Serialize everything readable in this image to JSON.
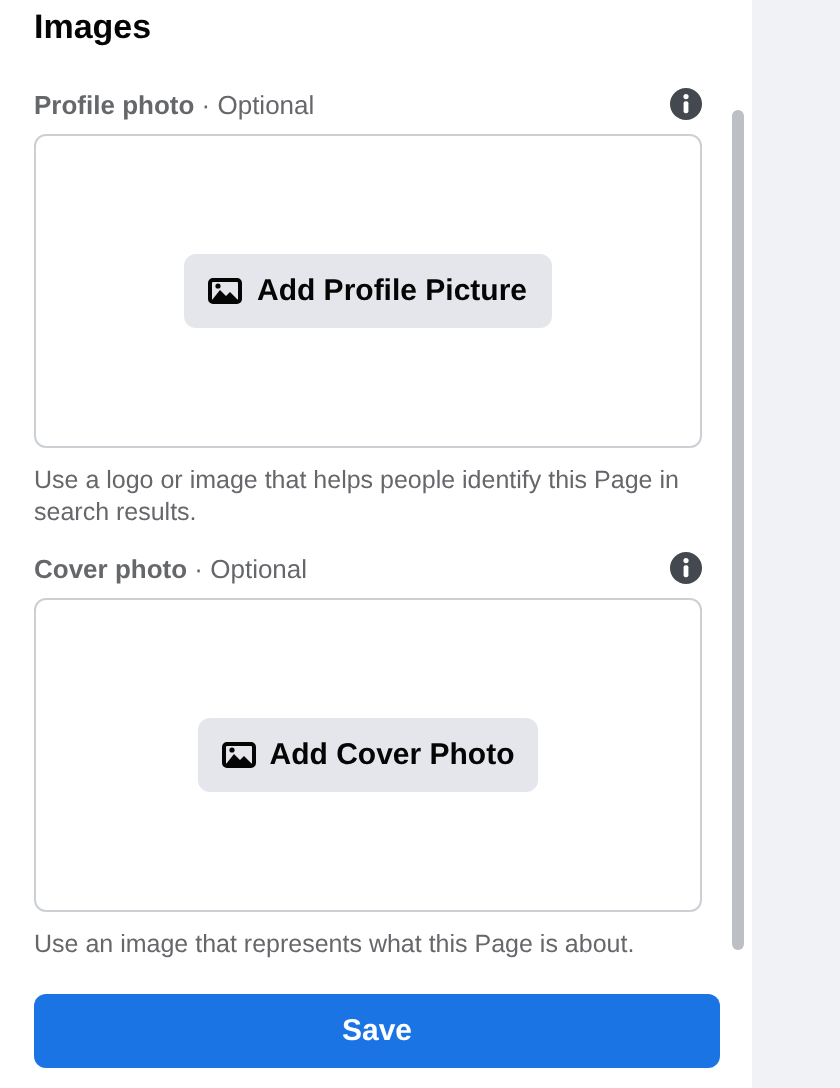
{
  "heading": "Images",
  "fields": [
    {
      "label": "Profile photo",
      "optional": "· Optional",
      "button": "Add Profile Picture",
      "help": "Use a logo or image that helps people identify this Page in search results."
    },
    {
      "label": "Cover photo",
      "optional": "· Optional",
      "button": "Add Cover Photo",
      "help": "Use an image that represents what this Page is about."
    }
  ],
  "save_button": "Save"
}
